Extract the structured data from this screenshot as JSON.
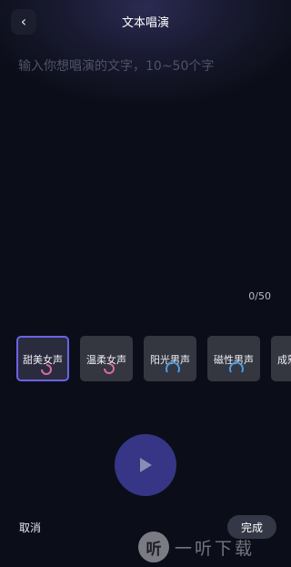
{
  "header": {
    "title": "文本唱演",
    "back_icon": "‹"
  },
  "editor": {
    "placeholder": "输入你想唱演的文字，10~50个字",
    "value": "",
    "counter": "0/50"
  },
  "voices": {
    "selected_index": 0,
    "items": [
      {
        "label": "甜美女声",
        "icon": "female-voice-icon",
        "color": "#d96aa8"
      },
      {
        "label": "温柔女声",
        "icon": "female-voice-icon",
        "color": "#d96aa8"
      },
      {
        "label": "阳光男声",
        "icon": "male-voice-icon",
        "color": "#4a9be0"
      },
      {
        "label": "磁性男声",
        "icon": "male-voice-icon",
        "color": "#4a9be0"
      },
      {
        "label": "成熟男声",
        "icon": "male-voice-icon",
        "color": "#4a9be0"
      }
    ]
  },
  "player": {
    "icon": "play-icon",
    "accent": "#363586"
  },
  "footer": {
    "cancel_label": "取消",
    "done_label": "完成"
  },
  "watermark": {
    "logo": "听",
    "text": "一听下载"
  }
}
